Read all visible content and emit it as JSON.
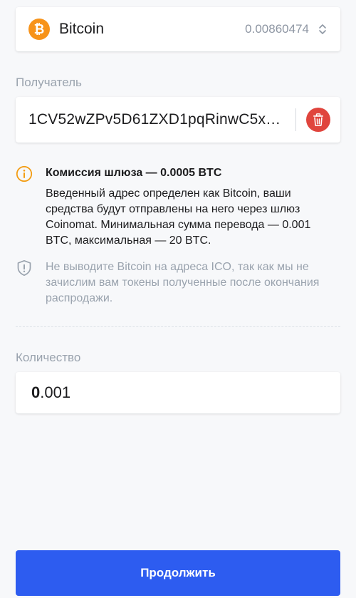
{
  "asset": {
    "icon": "bitcoin-icon",
    "icon_glyph": "₿",
    "name": "Bitcoin",
    "balance": "0.00860474",
    "color": "#f7931a"
  },
  "recipient": {
    "label": "Получатель",
    "address": "1CV52wZPv5D61ZXD1pqRinwC5x…"
  },
  "fee": {
    "title": "Комиссия шлюза — 0.0005 BTC",
    "description": "Введенный адрес определен как Bitcoin, ваши средства будут отправлены на него через шлюз Coinomat. Минимальная сумма перевода — 0.001 BTC, максимальная — 20 BTC."
  },
  "ico_warning": {
    "text": "Не выводите Bitcoin на адреса ICO, так как мы не зачислим вам токены полученные после окончания распродажи."
  },
  "amount": {
    "label": "Количество",
    "value_int": "0",
    "value_frac": ".001"
  },
  "actions": {
    "continue_label": "Продолжить",
    "accent": "#2d5cf0",
    "danger": "#e0453d"
  }
}
